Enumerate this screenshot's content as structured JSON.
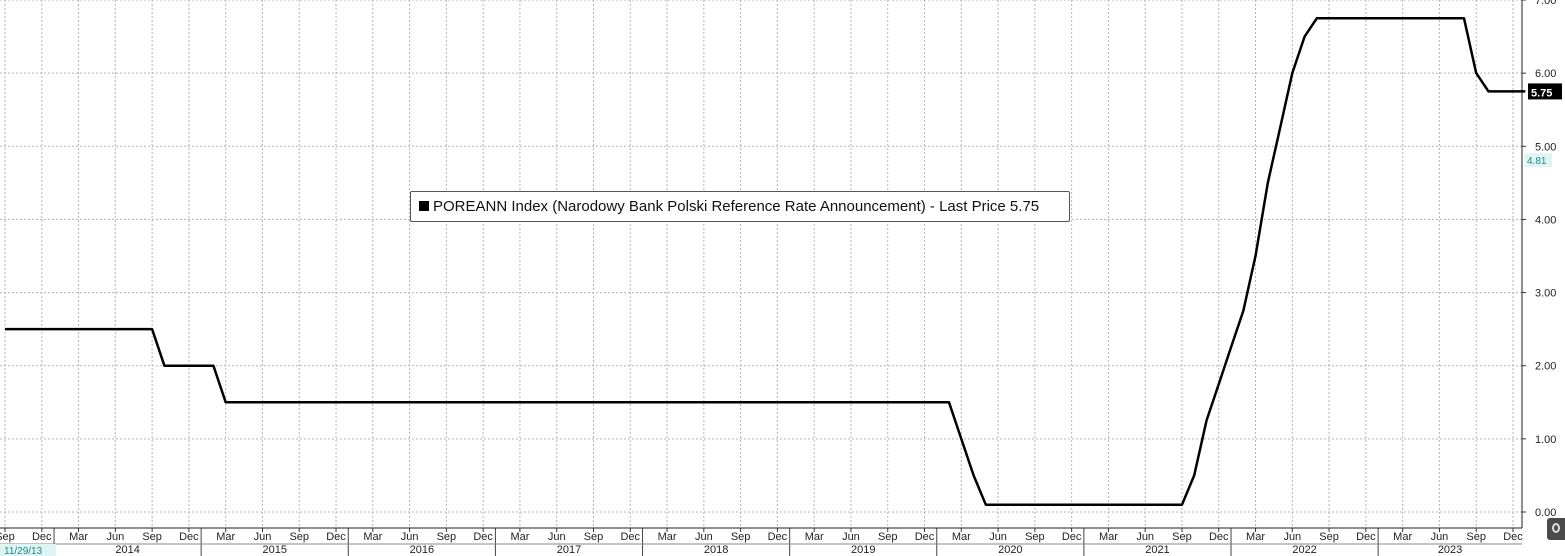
{
  "legend": {
    "text": "POREANN Index (Narodowy Bank Polski Reference Rate Announcement) - Last Price 5.75"
  },
  "last_price_label": "5.75",
  "secondary_marker_label": "4.81",
  "start_date_label": "11/29/13",
  "colors": {
    "line": "#000000",
    "grid": "#b4b4b4",
    "last_price_tag_bg": "#000000",
    "last_price_tag_text": "#ffffff",
    "secondary_marker_bg": "#e0f4f4",
    "secondary_marker_text": "#1f8a8a",
    "start_date_bg": "#e0f4f4",
    "start_date_text": "#1f8a8a"
  },
  "chart_data": {
    "type": "line",
    "title": "",
    "xlabel": "",
    "ylabel": "",
    "y_axis_side": "right",
    "ylim": [
      0,
      7
    ],
    "y_ticks": [
      "0.00",
      "1.00",
      "2.00",
      "3.00",
      "4.00",
      "5.00",
      "6.00",
      "7.00"
    ],
    "x_month_ticks": [
      {
        "label": "Sep",
        "date": "2013-09"
      },
      {
        "label": "Dec",
        "date": "2013-12"
      },
      {
        "label": "Mar",
        "date": "2014-03"
      },
      {
        "label": "Jun",
        "date": "2014-06"
      },
      {
        "label": "Sep",
        "date": "2014-09"
      },
      {
        "label": "Dec",
        "date": "2014-12"
      },
      {
        "label": "Mar",
        "date": "2015-03"
      },
      {
        "label": "Jun",
        "date": "2015-06"
      },
      {
        "label": "Sep",
        "date": "2015-09"
      },
      {
        "label": "Dec",
        "date": "2015-12"
      },
      {
        "label": "Mar",
        "date": "2016-03"
      },
      {
        "label": "Jun",
        "date": "2016-06"
      },
      {
        "label": "Sep",
        "date": "2016-09"
      },
      {
        "label": "Dec",
        "date": "2016-12"
      },
      {
        "label": "Mar",
        "date": "2017-03"
      },
      {
        "label": "Jun",
        "date": "2017-06"
      },
      {
        "label": "Sep",
        "date": "2017-09"
      },
      {
        "label": "Dec",
        "date": "2017-12"
      },
      {
        "label": "Mar",
        "date": "2018-03"
      },
      {
        "label": "Jun",
        "date": "2018-06"
      },
      {
        "label": "Sep",
        "date": "2018-09"
      },
      {
        "label": "Dec",
        "date": "2018-12"
      },
      {
        "label": "Mar",
        "date": "2019-03"
      },
      {
        "label": "Jun",
        "date": "2019-06"
      },
      {
        "label": "Sep",
        "date": "2019-09"
      },
      {
        "label": "Dec",
        "date": "2019-12"
      },
      {
        "label": "Mar",
        "date": "2020-03"
      },
      {
        "label": "Jun",
        "date": "2020-06"
      },
      {
        "label": "Sep",
        "date": "2020-09"
      },
      {
        "label": "Dec",
        "date": "2020-12"
      },
      {
        "label": "Mar",
        "date": "2021-03"
      },
      {
        "label": "Jun",
        "date": "2021-06"
      },
      {
        "label": "Sep",
        "date": "2021-09"
      },
      {
        "label": "Dec",
        "date": "2021-12"
      },
      {
        "label": "Mar",
        "date": "2022-03"
      },
      {
        "label": "Jun",
        "date": "2022-06"
      },
      {
        "label": "Sep",
        "date": "2022-09"
      },
      {
        "label": "Dec",
        "date": "2022-12"
      },
      {
        "label": "Mar",
        "date": "2023-03"
      },
      {
        "label": "Jun",
        "date": "2023-06"
      },
      {
        "label": "Sep",
        "date": "2023-09"
      },
      {
        "label": "Dec",
        "date": "2023-12"
      }
    ],
    "x_year_labels": [
      "2014",
      "2015",
      "2016",
      "2017",
      "2018",
      "2019",
      "2020",
      "2021",
      "2022",
      "2023"
    ],
    "series": [
      {
        "name": "POREANN Index",
        "points": [
          {
            "x": "2013-09",
            "y": 2.5
          },
          {
            "x": "2014-09",
            "y": 2.5
          },
          {
            "x": "2014-10",
            "y": 2.0
          },
          {
            "x": "2015-02",
            "y": 2.0
          },
          {
            "x": "2015-03",
            "y": 1.5
          },
          {
            "x": "2020-02",
            "y": 1.5
          },
          {
            "x": "2020-03",
            "y": 1.0
          },
          {
            "x": "2020-04",
            "y": 0.5
          },
          {
            "x": "2020-05",
            "y": 0.1
          },
          {
            "x": "2021-09",
            "y": 0.1
          },
          {
            "x": "2021-10",
            "y": 0.5
          },
          {
            "x": "2021-11",
            "y": 1.25
          },
          {
            "x": "2021-12",
            "y": 1.75
          },
          {
            "x": "2022-01",
            "y": 2.25
          },
          {
            "x": "2022-02",
            "y": 2.75
          },
          {
            "x": "2022-03",
            "y": 3.5
          },
          {
            "x": "2022-04",
            "y": 4.5
          },
          {
            "x": "2022-05",
            "y": 5.25
          },
          {
            "x": "2022-06",
            "y": 6.0
          },
          {
            "x": "2022-07",
            "y": 6.5
          },
          {
            "x": "2022-08",
            "y": 6.75
          },
          {
            "x": "2023-08",
            "y": 6.75
          },
          {
            "x": "2023-09",
            "y": 6.0
          },
          {
            "x": "2023-10",
            "y": 5.75
          },
          {
            "x": "2024-01",
            "y": 5.75
          }
        ]
      }
    ],
    "grid": true
  }
}
